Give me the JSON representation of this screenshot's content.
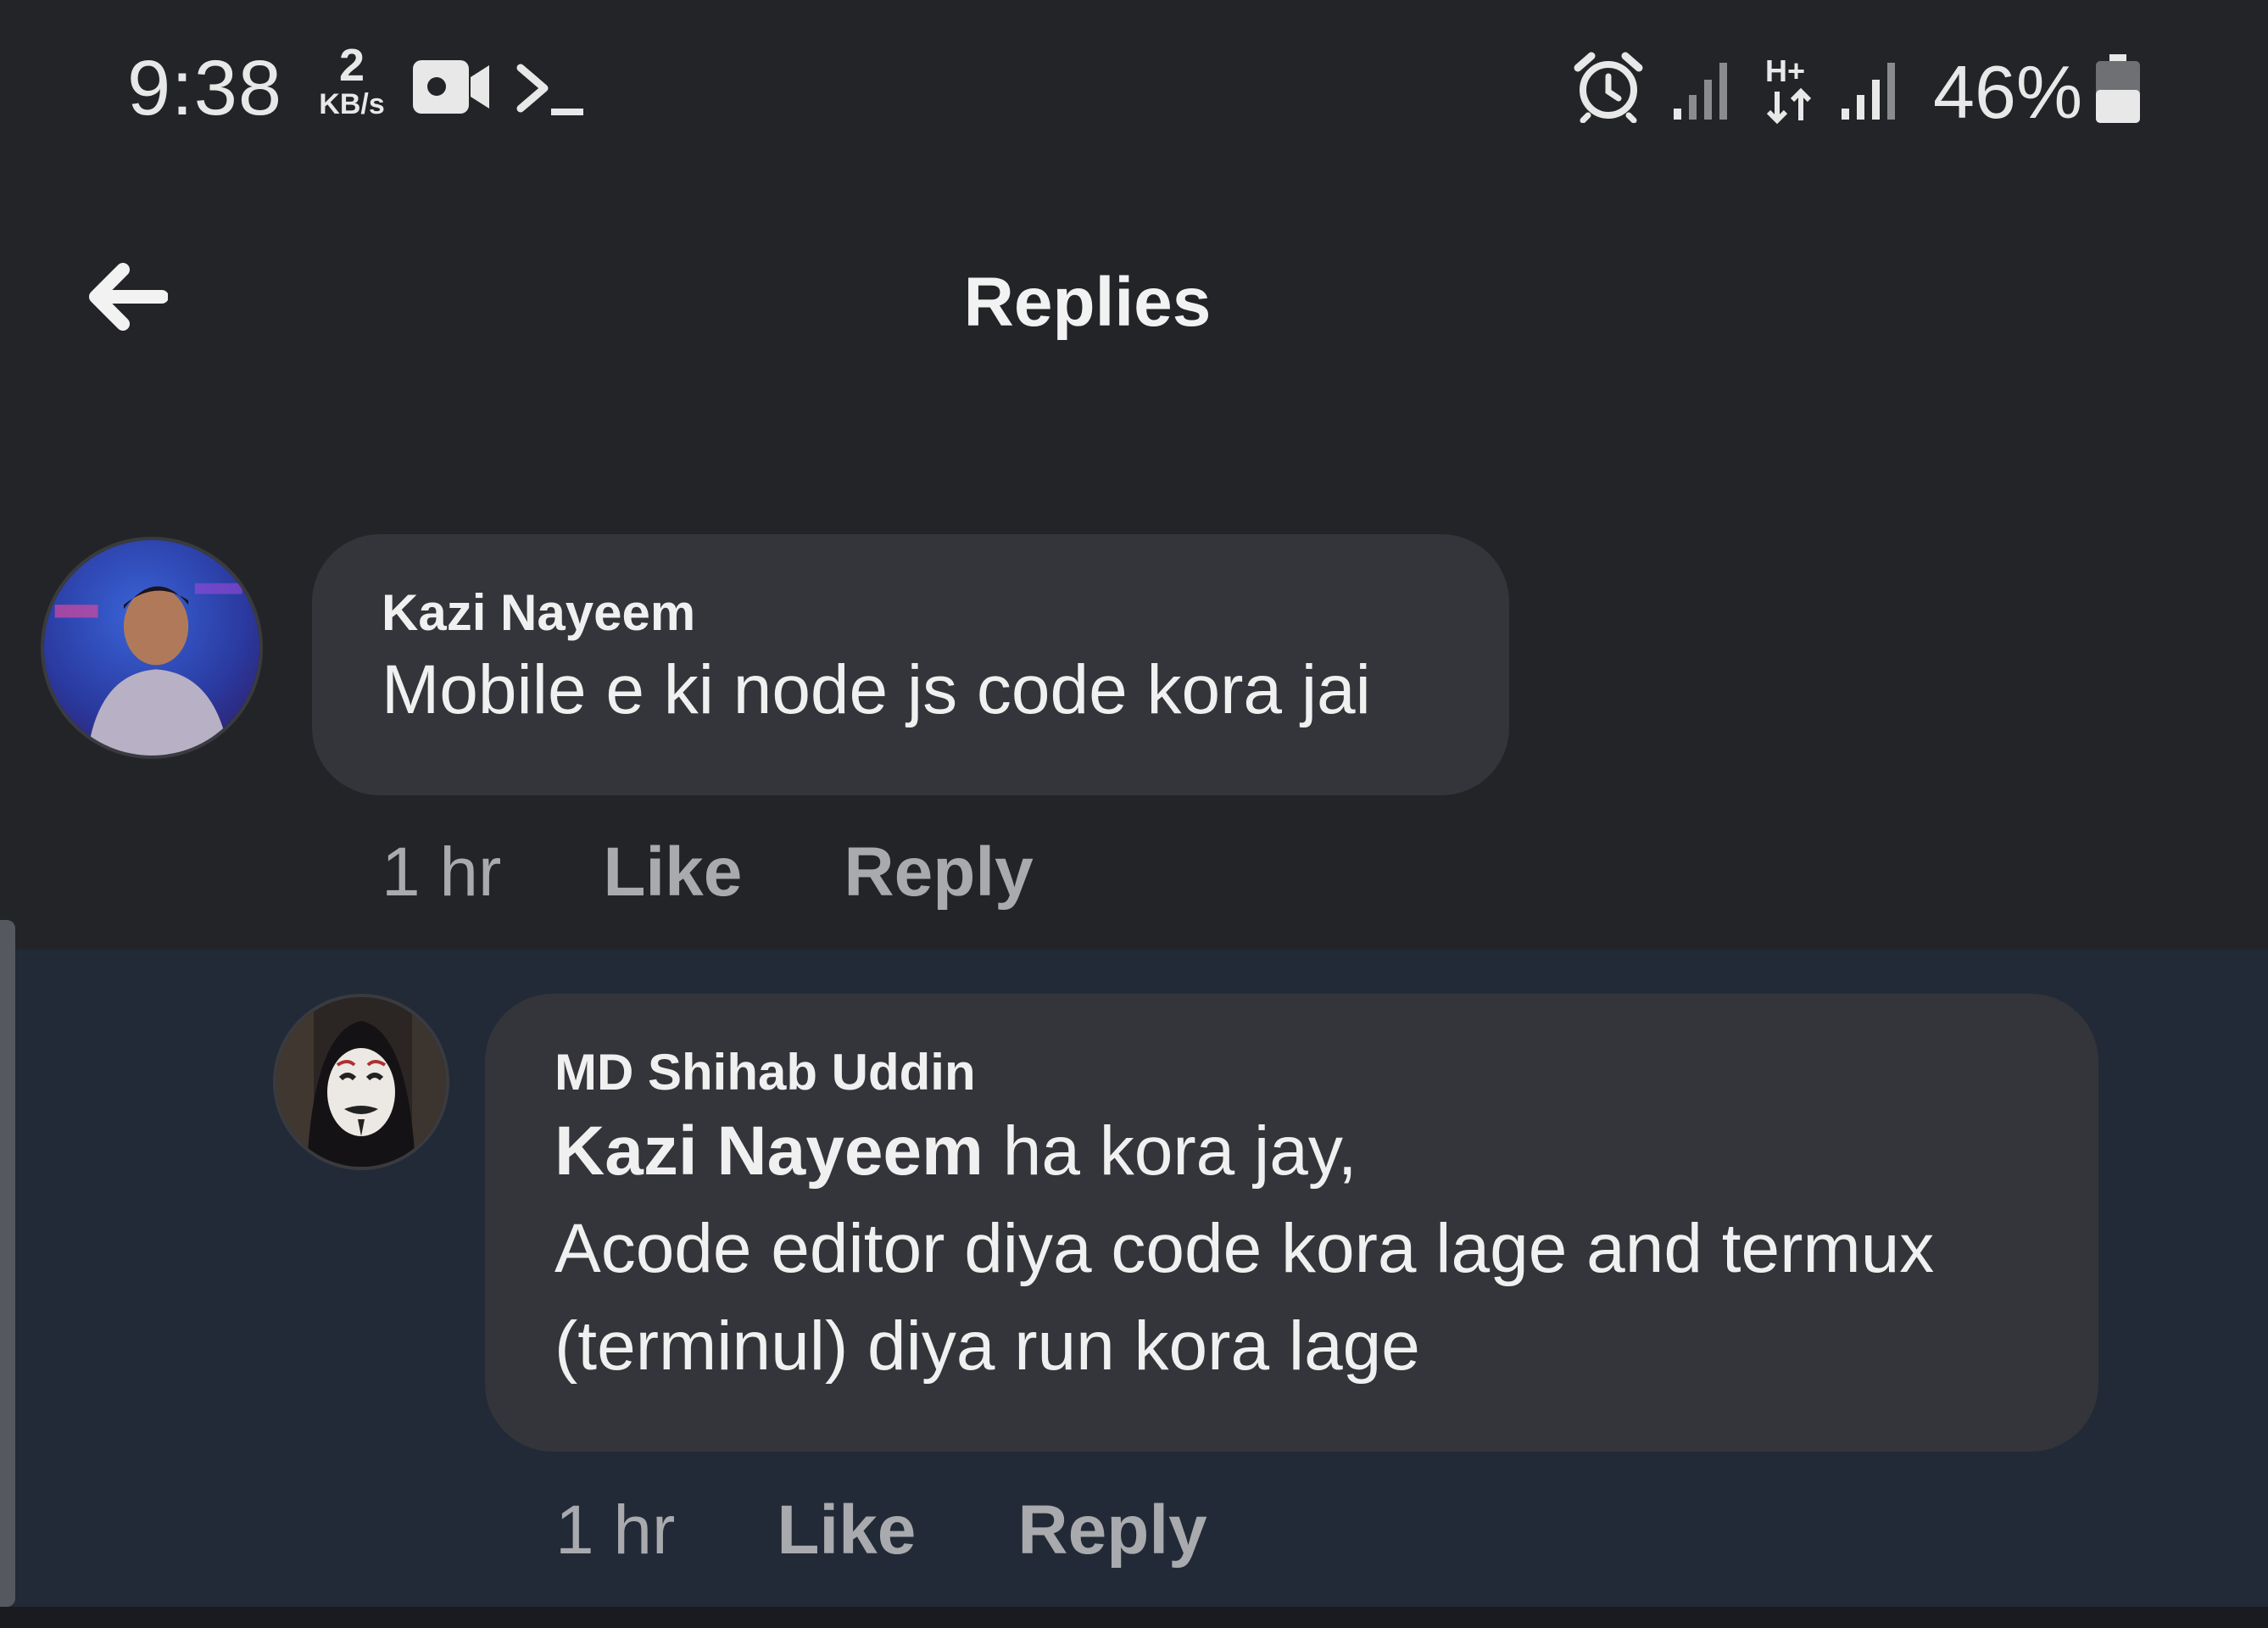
{
  "status_bar": {
    "time": "9:38",
    "net_speed_value": "2",
    "net_speed_unit": "KB/s",
    "battery_percent": "46%",
    "icons": [
      "video-camera-icon",
      "terminal-icon",
      "alarm-icon",
      "signal-icon",
      "data-arrows-icon",
      "signal-icon",
      "battery-icon"
    ],
    "network_type": "H+"
  },
  "header": {
    "back_icon": "arrow-left-icon",
    "title": "Replies"
  },
  "comments": [
    {
      "author": "Kazi Nayeem",
      "text": "Mobile e ki node js code kora jai",
      "time": "1 hr",
      "like_label": "Like",
      "reply_label": "Reply"
    },
    {
      "author": "MD Shihab Uddin",
      "mention": "Kazi Nayeem",
      "text_after_mention": " ha kora jay,",
      "text_line_2": "Acode editor diya code kora lage and termux",
      "text_line_3": "(terminul) diya run kora lage",
      "time": "1 hr",
      "like_label": "Like",
      "reply_label": "Reply"
    }
  ],
  "colors": {
    "background": "#232427",
    "bubble": "#34353a",
    "highlight": "#222a37",
    "text_primary": "#f0f0f0",
    "text_secondary": "#a8aaae"
  }
}
